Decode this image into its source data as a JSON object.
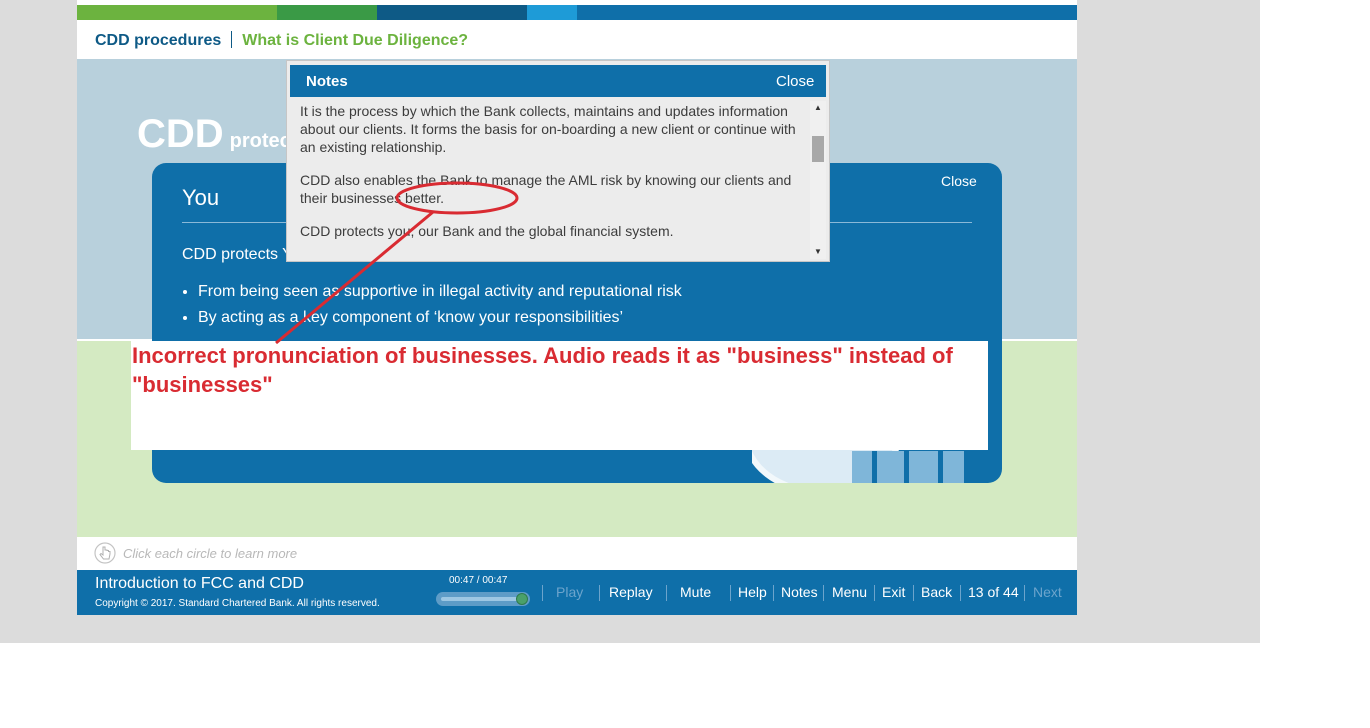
{
  "colors": {
    "brand_blue": "#0f6fa9",
    "brand_green": "#6cb33f",
    "annotation_red": "#d92b32",
    "top_stripe": [
      "#6cb33f",
      "#3a9a46",
      "#0e5a86",
      "#1e9bd7",
      "#0f6fa9"
    ]
  },
  "breadcrumb": {
    "course": "CDD procedures",
    "topic": "What is Client Due Diligence?"
  },
  "slide": {
    "heading": "CDD",
    "heading_sub": "protec"
  },
  "you_card": {
    "title": "You",
    "close_label": "Close",
    "intro": "CDD protects Y",
    "bullets": [
      "From being seen as supportive in illegal activity and reputational risk",
      "By acting as a key component of ‘know your responsibilities’"
    ]
  },
  "notes": {
    "title": "Notes",
    "close_label": "Close",
    "paragraphs": [
      "It is the process by which the Bank collects, maintains and updates information about our clients. It forms the basis for on-boarding a new client or continue with an existing relationship.",
      "CDD also enables the Bank to manage the AML risk by knowing our clients and their businesses better.",
      "CDD protects you, our Bank and the global financial system."
    ]
  },
  "callout": {
    "text": "Incorrect pronunciation of businesses. Audio reads it as \"business\" instead of \"businesses\""
  },
  "instruction": {
    "icon": "hand-pointer-icon",
    "text": "Click each circle to learn more"
  },
  "footer": {
    "course_title": "Introduction to FCC and CDD",
    "copyright": "Copyright © 2017. Standard Chartered Bank. All rights reserved.",
    "time": "00:47 / 00:47",
    "audio_progress": 1.0,
    "nav": {
      "play": "Play",
      "replay": "Replay",
      "mute": "Mute",
      "help": "Help",
      "notes": "Notes",
      "menu": "Menu",
      "exit": "Exit",
      "back": "Back",
      "page": "13 of 44",
      "next": "Next"
    }
  }
}
